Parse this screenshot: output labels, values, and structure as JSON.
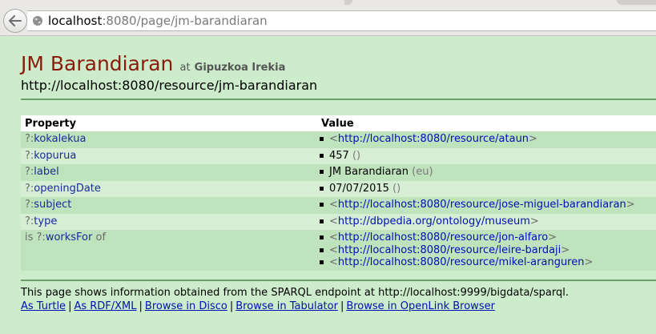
{
  "browser": {
    "url_host": "localhost",
    "url_rest": ":8080/page/jm-barandiaran"
  },
  "header": {
    "title": "JM Barandiaran",
    "at": "at",
    "dataset": "Gipuzkoa Irekia",
    "resource_uri": "http://localhost:8080/resource/jm-barandiaran"
  },
  "table": {
    "col_property": "Property",
    "col_value": "Value",
    "rows": [
      {
        "prefix": "?:",
        "prop": "kokalekua",
        "values": [
          {
            "lt": "<",
            "text": "http://localhost:8080/resource/ataun",
            "gt": ">"
          }
        ]
      },
      {
        "prefix": "?:",
        "prop": "kopurua",
        "values": [
          {
            "literal": "457",
            "suffix": "()"
          }
        ]
      },
      {
        "prefix": "?:",
        "prop": "label",
        "values": [
          {
            "literal": "JM Barandiaran",
            "suffix": "(eu)"
          }
        ]
      },
      {
        "prefix": "?:",
        "prop": "openingDate",
        "values": [
          {
            "literal": "07/07/2015",
            "suffix": "()"
          }
        ]
      },
      {
        "prefix": "?:",
        "prop": "subject",
        "values": [
          {
            "lt": "<",
            "text": "http://localhost:8080/resource/jose-miguel-barandiaran",
            "gt": ">"
          }
        ]
      },
      {
        "prefix": "?:",
        "prop": "type",
        "values": [
          {
            "lt": "<",
            "text": "http://dbpedia.org/ontology/museum",
            "gt": ">"
          }
        ]
      },
      {
        "is": "is",
        "prefix": "?:",
        "prop": "worksFor",
        "of": "of",
        "values": [
          {
            "lt": "<",
            "text": "http://localhost:8080/resource/jon-alfaro",
            "gt": ">"
          },
          {
            "lt": "<",
            "text": "http://localhost:8080/resource/leire-bardaji",
            "gt": ">"
          },
          {
            "lt": "<",
            "text": "http://localhost:8080/resource/mikel-aranguren",
            "gt": ">"
          }
        ]
      }
    ]
  },
  "footer": {
    "note": "This page shows information obtained from the SPARQL endpoint at http://localhost:9999/bigdata/sparql.",
    "links": [
      "As Turtle",
      "As RDF/XML",
      "Browse in Disco",
      "Browse in Tabulator",
      "Browse in OpenLink Browser"
    ],
    "separator": "|"
  },
  "colors": {
    "background": "#cdeccb",
    "title": "#8a1b0b",
    "link": "#0010b6",
    "row_even": "#bfe3bd",
    "row_odd": "#d6efd4"
  },
  "icons": [
    "back-arrow-icon",
    "globe-icon",
    "bullet-icon"
  ]
}
